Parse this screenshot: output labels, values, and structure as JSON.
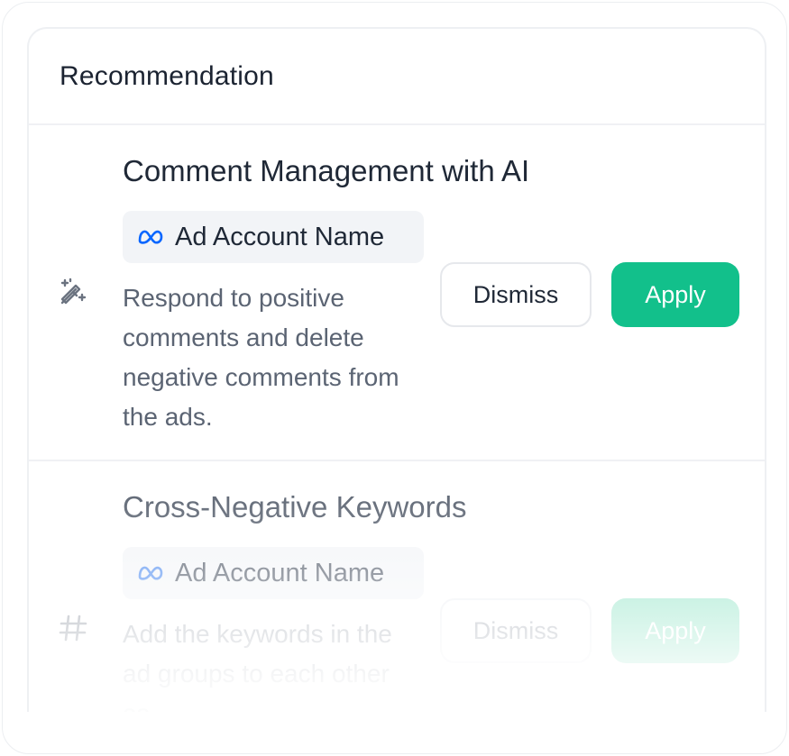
{
  "panel": {
    "title": "Recommendation"
  },
  "recommendations": [
    {
      "icon": "magic-wand-icon",
      "title": "Comment Management with AI",
      "account": {
        "icon": "meta-logo-icon",
        "label": "Ad Account Name"
      },
      "description": "Respond to positive comments and delete negative comments from the ads.",
      "dismiss_label": "Dismiss",
      "apply_label": "Apply"
    },
    {
      "icon": "hashtag-icon",
      "title": "Cross-Negative Keywords",
      "account": {
        "icon": "meta-logo-icon",
        "label": "Ad Account Name"
      },
      "description": "Add the keywords  in the ad groups to each other as",
      "dismiss_label": "Dismiss",
      "apply_label": "Apply"
    }
  ],
  "colors": {
    "apply_button": "#12C08B",
    "meta_blue": "#0866FF",
    "title_text": "#1B2331",
    "description_text": "#5B6473"
  }
}
